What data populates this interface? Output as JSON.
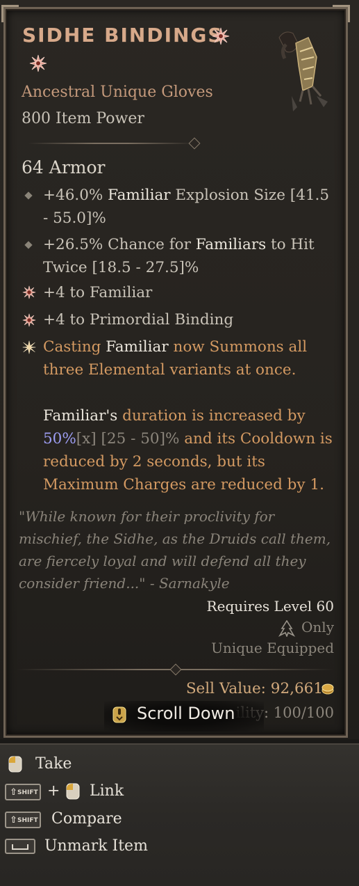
{
  "item": {
    "name": "SIDHE BINDINGS",
    "type": "Ancestral Unique Gloves",
    "item_power": "800 Item Power",
    "armor": "64 Armor",
    "affixes": [
      {
        "pre": "+46.0% ",
        "hl": "Familiar",
        "post": " Explosion Size [41.5 - 55.0]%"
      },
      {
        "pre": "+26.5% Chance for ",
        "hl": "Familiars",
        "post": " to Hit Twice [18.5 - 27.5]%"
      }
    ],
    "skill_affixes": [
      "+4 to Familiar",
      "+4 to Primordial Binding"
    ],
    "unique_power": {
      "p1_a": "Casting ",
      "p1_b": "Familiar",
      "p1_c": " now Summons all three Elemental variants at once.",
      "p2_a": "Familiar's",
      "p2_b": " duration is increased by ",
      "p2_val": "50%",
      "p2_x": "[x]",
      "p2_range": " [25 - 50]%",
      "p2_c": " and its Cooldown is reduced by 2 seconds, but its Maximum Charges are reduced by 1."
    },
    "flavor": "\"While known for their proclivity for mischief, the Sidhe, as the Druids call them, are fiercely loyal and will defend all they consider friend...\"  - Sarnakyle",
    "requires": "Requires Level 60",
    "class_only": "Only",
    "unique_equipped": "Unique Equipped",
    "sell_value": "Sell Value: 92,661",
    "durability": "ility: 100/100"
  },
  "scroll_down": "Scroll Down",
  "actions": {
    "take": "Take",
    "plus": "+",
    "link": "Link",
    "compare": "Compare",
    "unmark": "Unmark Item",
    "shift_key": "SHIFT"
  },
  "colors": {
    "title": "#d7a98a",
    "unique_text": "#d49a62",
    "highlight_value": "#9d9df2"
  }
}
